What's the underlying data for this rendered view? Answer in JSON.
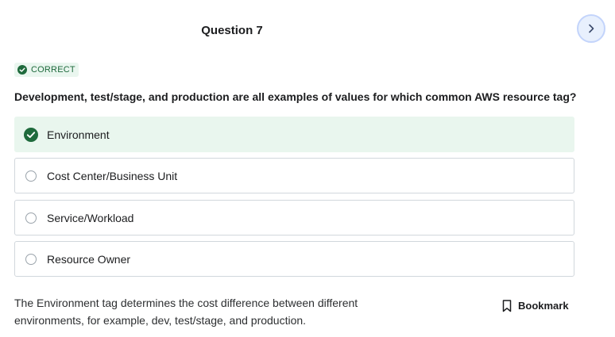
{
  "question": {
    "title": "Question 7",
    "status": "CORRECT",
    "prompt": "Development, test/stage, and production are all examples of values for which common AWS resource tag?"
  },
  "options": [
    {
      "label": "Environment",
      "state": "correct"
    },
    {
      "label": "Cost Center/Business Unit",
      "state": "unselected"
    },
    {
      "label": "Service/Workload",
      "state": "unselected"
    },
    {
      "label": "Resource Owner",
      "state": "unselected"
    }
  ],
  "explanation": "The Environment tag determines the cost difference between different environments, for example, dev, test/stage, and production.",
  "actions": {
    "bookmark_label": "Bookmark",
    "next_icon": "chevron-right-icon",
    "bookmark_icon": "bookmark-icon"
  },
  "colors": {
    "correct": "#1e6a3c",
    "correct_bg": "#e9f6ee",
    "next_button_bg": "#e8f0fd"
  }
}
